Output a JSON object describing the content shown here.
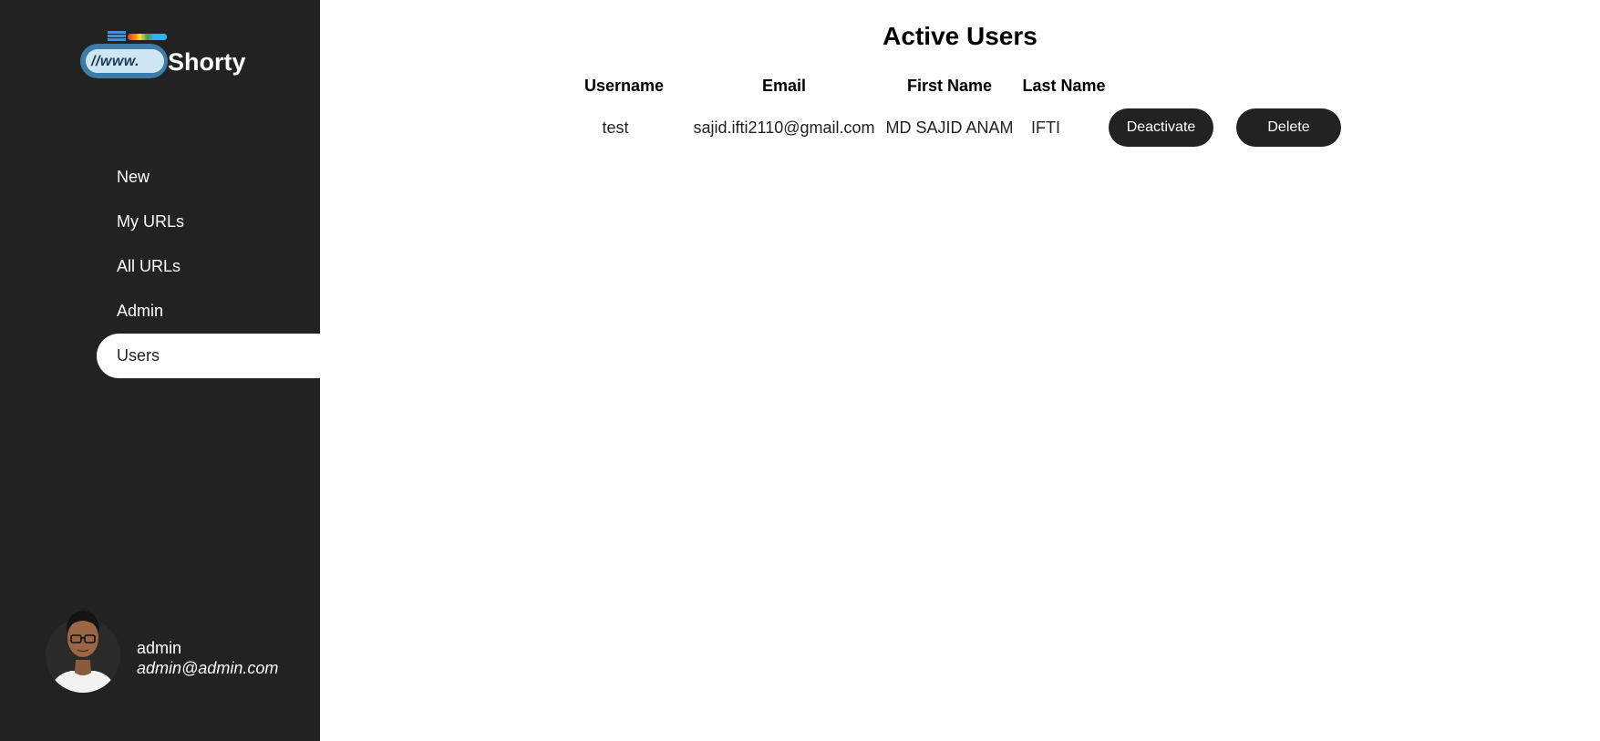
{
  "app": {
    "logo_www": "//www.",
    "logo_name": "Shorty"
  },
  "sidebar": {
    "items": [
      {
        "label": "New",
        "active": false
      },
      {
        "label": "My URLs",
        "active": false
      },
      {
        "label": "All URLs",
        "active": false
      },
      {
        "label": "Admin",
        "active": false
      },
      {
        "label": "Users",
        "active": true
      }
    ]
  },
  "profile": {
    "name": "admin",
    "email": "admin@admin.com"
  },
  "main": {
    "title": "Active Users",
    "columns": [
      "Username",
      "Email",
      "First Name",
      "Last Name"
    ],
    "rows": [
      {
        "username": "test",
        "email": "sajid.ifti2110@gmail.com",
        "first_name": "MD SAJID ANAM",
        "last_name": "IFTI",
        "deactivate_label": "Deactivate",
        "delete_label": "Delete"
      }
    ]
  },
  "colors": {
    "sidebar_bg": "#222222",
    "accent": "#222222",
    "page_bg": "#ffffff"
  }
}
